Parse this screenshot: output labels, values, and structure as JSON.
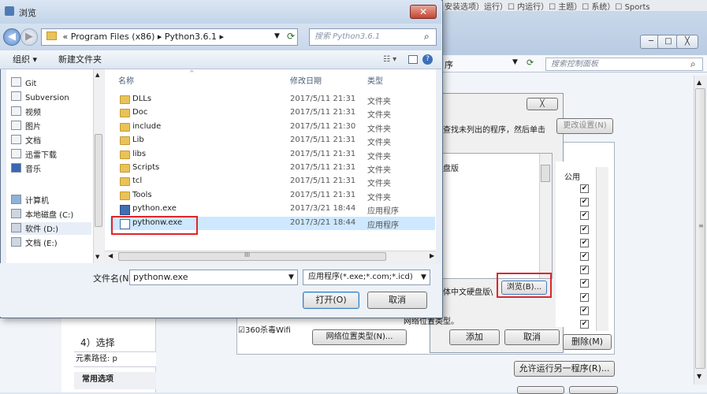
{
  "background": {
    "top_strip_text": "安装选项）运行）☐ 内运行）☐ 主题）☐ 系统）☐ Sports",
    "window_controls": {
      "minimize": "─",
      "maximize": "□",
      "close": "╳"
    },
    "search_placeholder": "搜索控制面板",
    "addr_fragment": "序",
    "inner_close": "╳",
    "inner_text_line": "查找未列出的程序，然后单击",
    "change_settings_btn": "更改设置(N)",
    "list_item_fragment": "盘版",
    "public_col": "公用",
    "ime_fragment": "体中文硬盘版\\",
    "browse_btn": "浏览(B)...",
    "network_type_line": "网络位置类型。",
    "checkbox_360": "360杀毒Wifi",
    "network_type_btn": "网络位置类型(N)...",
    "add_btn": "添加",
    "cancel_btn": "取消",
    "delete_btn": "删除(M)",
    "allow_another_btn": "允许运行另一程序(R)...",
    "step_text": "4）选择",
    "element_path": "元素路径: p",
    "common_options": "常用选项",
    "checkbox_count": 11
  },
  "dialog": {
    "title": "浏览",
    "close_glyph": "✕",
    "breadcrumb": [
      "«",
      "Program Files (x86)",
      "▸",
      "Python3.6.1",
      "▸"
    ],
    "search_placeholder": "搜索 Python3.6.1",
    "toolbar": {
      "organize": "组织 ▾",
      "new_folder": "新建文件夹"
    },
    "nav_items": [
      {
        "label": "Git",
        "icon": "folder-icon"
      },
      {
        "label": "Subversion",
        "icon": "folder-icon"
      },
      {
        "label": "视频",
        "icon": "video-icon"
      },
      {
        "label": "图片",
        "icon": "picture-icon"
      },
      {
        "label": "文档",
        "icon": "document-icon"
      },
      {
        "label": "迅雷下载",
        "icon": "download-icon"
      },
      {
        "label": "音乐",
        "icon": "music-icon"
      },
      {
        "label": "计算机",
        "icon": "computer-icon"
      },
      {
        "label": "本地磁盘 (C:)",
        "icon": "drive-icon"
      },
      {
        "label": "软件 (D:)",
        "icon": "drive-icon"
      },
      {
        "label": "文档 (E:)",
        "icon": "drive-icon"
      }
    ],
    "columns": {
      "name": "名称",
      "date": "修改日期",
      "type": "类型"
    },
    "files": [
      {
        "name": "DLLs",
        "date": "2017/5/11 21:31",
        "type": "文件夹",
        "kind": "folder"
      },
      {
        "name": "Doc",
        "date": "2017/5/11 21:31",
        "type": "文件夹",
        "kind": "folder"
      },
      {
        "name": "include",
        "date": "2017/5/11 21:30",
        "type": "文件夹",
        "kind": "folder"
      },
      {
        "name": "Lib",
        "date": "2017/5/11 21:31",
        "type": "文件夹",
        "kind": "folder"
      },
      {
        "name": "libs",
        "date": "2017/5/11 21:31",
        "type": "文件夹",
        "kind": "folder"
      },
      {
        "name": "Scripts",
        "date": "2017/5/11 21:31",
        "type": "文件夹",
        "kind": "folder"
      },
      {
        "name": "tcl",
        "date": "2017/5/11 21:31",
        "type": "文件夹",
        "kind": "folder"
      },
      {
        "name": "Tools",
        "date": "2017/5/11 21:31",
        "type": "文件夹",
        "kind": "folder"
      },
      {
        "name": "python.exe",
        "date": "2017/3/21 18:44",
        "type": "应用程序",
        "kind": "exe"
      },
      {
        "name": "pythonw.exe",
        "date": "2017/3/21 18:44",
        "type": "应用程序",
        "kind": "exew",
        "selected": true
      }
    ],
    "filename_label": "文件名(N):",
    "filename_value": "pythonw.exe",
    "filetype_value": "应用程序(*.exe;*.com;*.icd)",
    "open_btn": "打开(O)",
    "cancel_btn": "取消",
    "hscroll_mark": "III"
  },
  "colors": {
    "highlight": "#e0252b",
    "selection": "#cde8ff"
  }
}
